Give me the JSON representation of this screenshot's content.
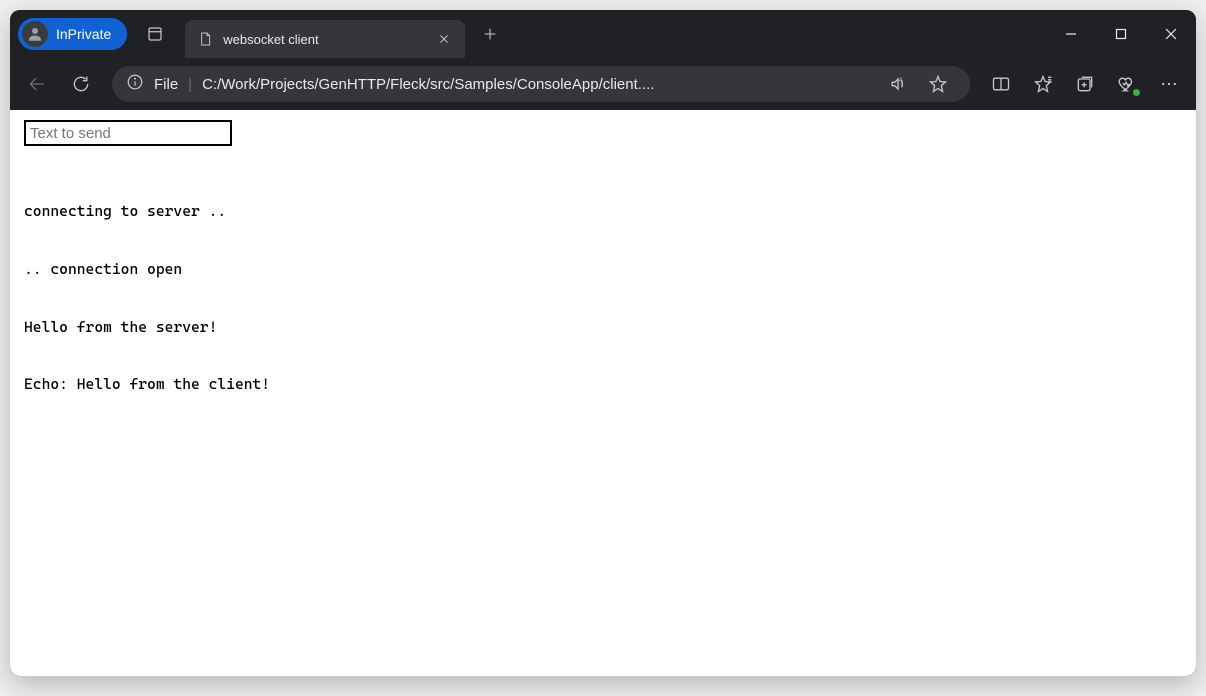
{
  "browser": {
    "inprivate_label": "InPrivate",
    "tab_title": "websocket client",
    "url_scheme": "File",
    "url_separator": "|",
    "url_path": "C:/Work/Projects/GenHTTP/Fleck/src/Samples/ConsoleApp/client....",
    "icons": {
      "workspaces": "workspaces-icon",
      "page": "page-icon",
      "close_tab": "close-icon",
      "new_tab": "plus-icon",
      "min": "minimize-icon",
      "max": "maximize-icon",
      "win_close": "close-icon",
      "back": "back-icon",
      "refresh": "refresh-icon",
      "info": "info-icon",
      "read_aloud": "read-aloud-icon",
      "favorite": "star-icon",
      "split": "split-screen-icon",
      "favorites": "favorites-star-icon",
      "collections": "collections-icon",
      "performance": "performance-icon",
      "menu": "menu-icon"
    }
  },
  "page": {
    "input_placeholder": "Text to send",
    "input_value": "",
    "log_lines": [
      "connecting to server ..",
      ".. connection open",
      "Hello from the server!",
      "Echo: Hello from the client!"
    ]
  }
}
